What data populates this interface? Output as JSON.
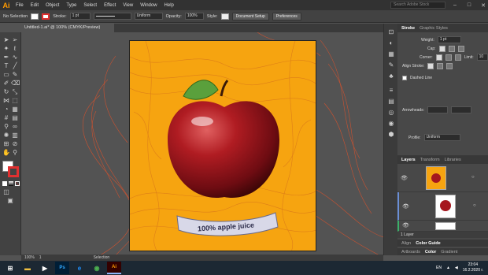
{
  "app": {
    "logo": "Ai"
  },
  "menu": [
    "File",
    "Edit",
    "Object",
    "Type",
    "Select",
    "Effect",
    "View",
    "Window",
    "Help"
  ],
  "search_placeholder": "Search Adobe Stock",
  "control_bar": {
    "selection": "No Selection",
    "stroke_label": "Stroke:",
    "stroke_value": "1 pt",
    "uniform_label": "Uniform",
    "opacity_label": "Opacity:",
    "opacity_value": "100%",
    "style_label": "Style:",
    "doc_setup": "Document Setup",
    "preferences": "Preferences"
  },
  "document_tab": "Untitled-1.ai* @ 100% (CMYK/Preview)",
  "artwork": {
    "label_text": "100% apple juice",
    "colors": {
      "background": "#f6a410",
      "apple": "#a5161e",
      "leaf": "#5aa03c",
      "line": "#e0522a"
    }
  },
  "status_bar": {
    "zoom": "100%",
    "page": "1",
    "mode": "Selection"
  },
  "stroke_panel": {
    "tab_active": "Stroke",
    "tab_other": "Graphic Styles",
    "weight_label": "Weight:",
    "weight_value": "1 pt",
    "cap_label": "Cap:",
    "corner_label": "Corner:",
    "limit_label": "Limit:",
    "limit_value": "10",
    "align_label": "Align Stroke:",
    "dashed_label": "Dashed Line",
    "arrowheads_label": "Arrowheads:",
    "profile_label": "Profile:",
    "profile_value": "Uniform"
  },
  "layers_panel": {
    "tabs": [
      "Layers",
      "Transform",
      "Libraries"
    ],
    "footer": "1 Layer"
  },
  "bottom_tabs": [
    "Align",
    "Color Guide"
  ],
  "bottom_tabs2": [
    "Artboards",
    "Color",
    "Gradient"
  ],
  "tray": {
    "lang": "EN",
    "time": "23:04",
    "date": "16.2.2020 г."
  }
}
